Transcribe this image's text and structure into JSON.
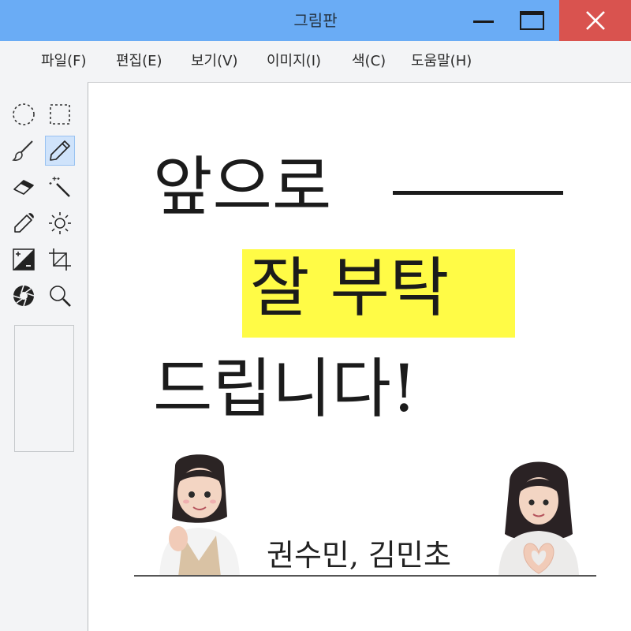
{
  "window": {
    "title": "그림판"
  },
  "menu": [
    {
      "label": "파일(F)"
    },
    {
      "label": "편집(E)"
    },
    {
      "label": "보기(V)"
    },
    {
      "label": "이미지(I)"
    },
    {
      "label": "색(C)"
    },
    {
      "label": "도움말(H)"
    }
  ],
  "tools": [
    "ellipse-select-icon",
    "rect-select-icon",
    "brush-icon",
    "pencil-icon",
    "eraser-icon",
    "magic-wand-icon",
    "eyedropper-icon",
    "brightness-icon",
    "invert-icon",
    "crop-icon",
    "aperture-icon",
    "zoom-icon"
  ],
  "active_tool": "pencil-icon",
  "canvas": {
    "line1": "앞으로",
    "line2": "잘 부탁",
    "line3": "드립니다!",
    "names": "권수민, 김민초",
    "highlight_color": "#fffb46"
  },
  "colors": {
    "titlebar": "#6aacf5",
    "close_button": "#d9534f",
    "active_tool": "#cfe3fb"
  }
}
